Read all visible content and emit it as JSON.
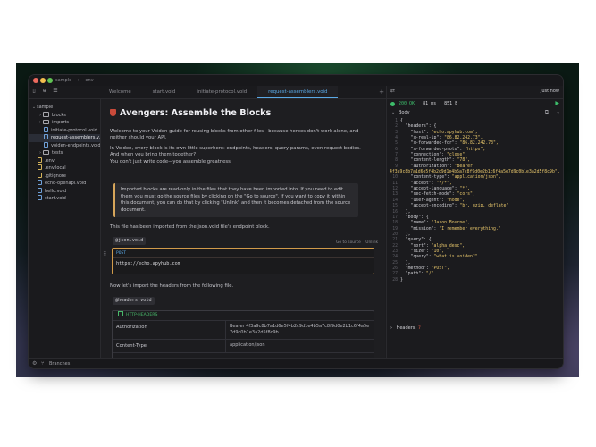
{
  "window": {
    "breadcrumb": [
      "sample",
      "›",
      "env"
    ]
  },
  "tabs": [
    {
      "label": "Welcome",
      "active": false
    },
    {
      "label": "start.void",
      "active": false
    },
    {
      "label": "initiate-protocol.void",
      "active": false
    },
    {
      "label": "request-assemblers.void",
      "active": true
    }
  ],
  "sidebar": {
    "items": [
      {
        "label": "sample",
        "type": "root",
        "indent": 0
      },
      {
        "label": "blocks",
        "type": "folder",
        "indent": 1
      },
      {
        "label": "imports",
        "type": "folder",
        "indent": 1
      },
      {
        "label": "initiate-protocol.void",
        "type": "file",
        "indent": 2
      },
      {
        "label": "request-assemblers.v...",
        "type": "file",
        "indent": 2,
        "active": true
      },
      {
        "label": "voiden-endpoints.void",
        "type": "file",
        "indent": 2
      },
      {
        "label": "tests",
        "type": "folder",
        "indent": 1
      },
      {
        "label": ".env",
        "type": "dot",
        "indent": 1
      },
      {
        "label": ".env.local",
        "type": "dot",
        "indent": 1
      },
      {
        "label": ".gitignore",
        "type": "dot",
        "indent": 1
      },
      {
        "label": "echo-openapi.void",
        "type": "file",
        "indent": 1
      },
      {
        "label": "hello.void",
        "type": "file",
        "indent": 1
      },
      {
        "label": "start.void",
        "type": "file",
        "indent": 1
      }
    ]
  },
  "editor": {
    "title": "Avengers: Assemble the Blocks",
    "intro1": "Welcome to your Voiden guide for reusing blocks from other files—because heroes don't work alone, and neither should your API.",
    "intro2": "In Voiden, every block is its own little superhero: endpoints, headers, query params, even request bodies. And when you bring them together?",
    "intro3": "You don't just write code—you assemble greatness.",
    "quote": "Imported blocks are read-only in the files that they have been imported into. If you need to edit them you must go the source files by clicking on the \"Go to source\". If you want to copy it within this document, you can do that by clicking \"Unlink\" and then it becomes detached from the source document.",
    "imported_note": "This file has been imported from the json.void file's endpoint block.",
    "chip1": "@json.void",
    "goto_source": "Go to source",
    "unlink": "Unlink",
    "method": "POST",
    "url": "https://echo.apyhub.com",
    "headers_note": "Now let's import the headers from the following file.",
    "chip2": "@headers.void",
    "headers_block_title": "HTTP-HEADERS",
    "headers_rows": [
      {
        "key": "Authorization",
        "value": "Bearer 4f3a9c8b7a1d6e5f4b2c9d1e4b5a7c8f9d0e2b1c6f4a5e7d9c0b1e3a2d5f8c9b"
      },
      {
        "key": "Content-Type",
        "value": "application/json"
      }
    ]
  },
  "response": {
    "just_now": "Just now",
    "status": "200 OK",
    "time": "81 ms",
    "size": "851 B",
    "body_tab": "Body",
    "headers_section": "Headers",
    "headers_badge": "7",
    "lines": [
      {
        "n": "1",
        "t": "{"
      },
      {
        "n": "2",
        "t": "  \"headers\": {"
      },
      {
        "n": "3",
        "t": "    \"host\": \"echo.apyhub.com\","
      },
      {
        "n": "4",
        "t": "    \"x-real-ip\": \"86.82.242.73\","
      },
      {
        "n": "5",
        "t": "    \"x-forwarded-for\": \"86.82.242.73\","
      },
      {
        "n": "6",
        "t": "    \"x-forwarded-proto\": \"https\","
      },
      {
        "n": "7",
        "t": "    \"connection\": \"close\","
      },
      {
        "n": "8",
        "t": "    \"content-length\": \"78\","
      },
      {
        "n": "9",
        "t": "    \"authorization\": \"Bearer"
      },
      {
        "n": "",
        "t": "4f3a9c8b7a1d6e5f4b2c9d1e4b5a7c8f9d0e2b1c6f4a5e7d9c0b1e3a2d5f8c9b\","
      },
      {
        "n": "10",
        "t": "    \"content-type\": \"application/json\","
      },
      {
        "n": "11",
        "t": "    \"accept\": \"*/*\","
      },
      {
        "n": "12",
        "t": "    \"accept-language\": \"*\","
      },
      {
        "n": "13",
        "t": "    \"sec-fetch-mode\": \"cors\","
      },
      {
        "n": "14",
        "t": "    \"user-agent\": \"node\","
      },
      {
        "n": "15",
        "t": "    \"accept-encoding\": \"br, gzip, deflate\""
      },
      {
        "n": "16",
        "t": "  },"
      },
      {
        "n": "17",
        "t": "  \"body\": {"
      },
      {
        "n": "18",
        "t": "    \"name\": \"Jason Bourne\","
      },
      {
        "n": "19",
        "t": "    \"mission\": \"I remember everything.\""
      },
      {
        "n": "20",
        "t": "  },"
      },
      {
        "n": "21",
        "t": "  \"query\": {"
      },
      {
        "n": "22",
        "t": "    \"sort\": \"alpha_desc\","
      },
      {
        "n": "23",
        "t": "    \"size\": \"10\","
      },
      {
        "n": "24",
        "t": "    \"query\": \"what is voiden?\""
      },
      {
        "n": "25",
        "t": "  },"
      },
      {
        "n": "26",
        "t": "  \"method\": \"POST\","
      },
      {
        "n": "27",
        "t": "  \"path\": \"/\""
      },
      {
        "n": "28",
        "t": "}"
      }
    ]
  },
  "statusbar": {
    "branches": "Branches"
  },
  "colors": {
    "accent": "#5aa9e6",
    "success": "#3dbd6b",
    "block_border": "#d09a4a",
    "string": "#e7c66b"
  }
}
